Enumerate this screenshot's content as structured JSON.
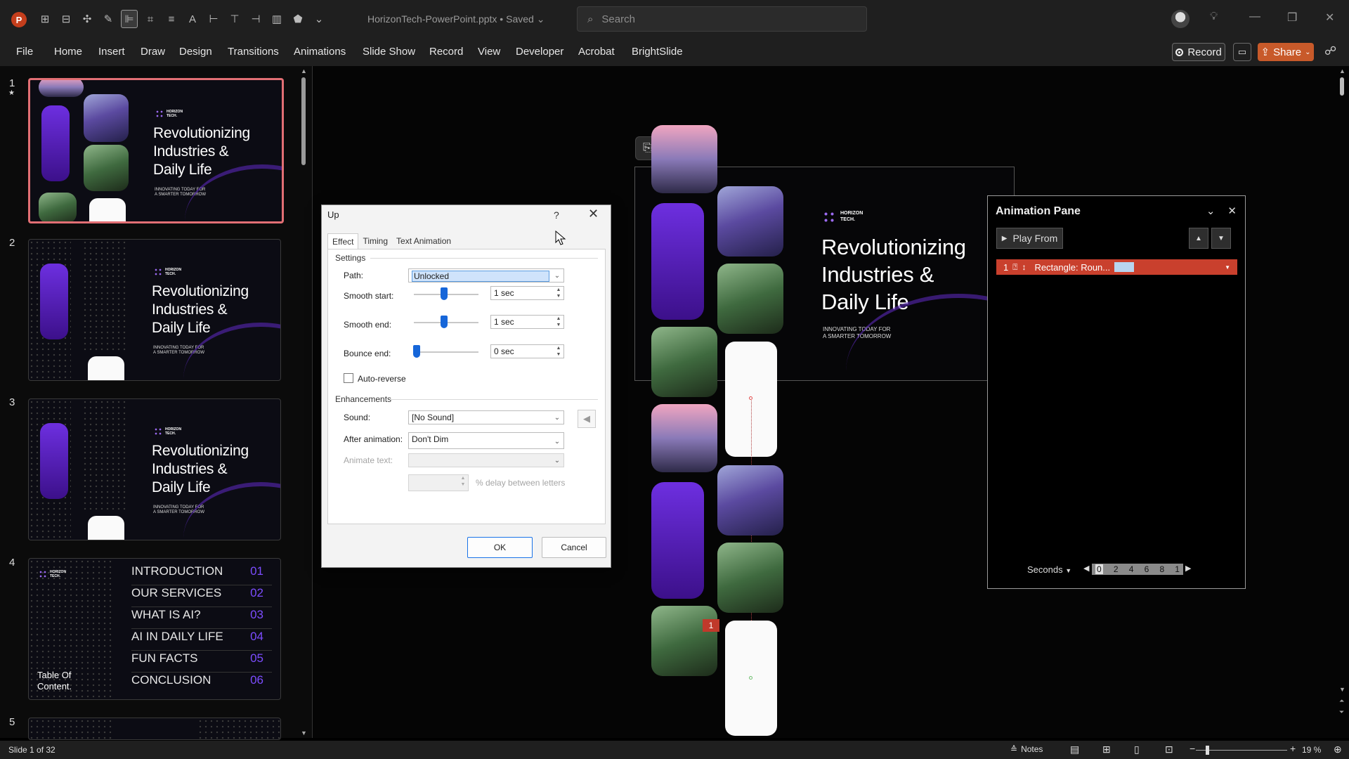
{
  "titlebar": {
    "app_logo": "P",
    "doc_title": "HorizonTech-PowerPoint.pptx • Saved",
    "search_placeholder": "Search",
    "qat_icons": [
      "shape-merge-icon",
      "shape-union-icon",
      "shape-combine-icon",
      "brush-icon",
      "format-align-icon",
      "crop-icon",
      "text-direction-icon",
      "text-icon",
      "align-left-icon",
      "align-top-icon",
      "align-right-icon",
      "chart-icon",
      "shape-icon",
      "more-icon"
    ]
  },
  "menu": {
    "items": [
      "File",
      "Home",
      "Insert",
      "Draw",
      "Design",
      "Transitions",
      "Animations",
      "Slide Show",
      "Record",
      "View",
      "Developer",
      "Acrobat",
      "BrightSlide"
    ],
    "record_label": "Record",
    "share_label": "Share"
  },
  "thumbnails": {
    "numbers": [
      "1",
      "2",
      "3",
      "4",
      "5"
    ],
    "logo_text": "HORIZON TECH.",
    "heading_lines": [
      "Revolutionizing",
      "Industries &",
      "Daily Life"
    ],
    "subtitle_lines": [
      "INNOVATING TODAY FOR",
      "A SMARTER TOMORROW"
    ],
    "toc": {
      "side_title_lines": [
        "Table Of",
        "Content."
      ],
      "rows": [
        {
          "label": "INTRODUCTION",
          "num": "01"
        },
        {
          "label": "OUR SERVICES",
          "num": "02"
        },
        {
          "label": "WHAT IS AI?",
          "num": "03"
        },
        {
          "label": "AI IN DAILY LIFE",
          "num": "04"
        },
        {
          "label": "FUN FACTS",
          "num": "05"
        },
        {
          "label": "CONCLUSION",
          "num": "06"
        }
      ]
    }
  },
  "canvas": {
    "logo_text": "HORIZON TECH.",
    "heading_lines": [
      "Revolutionizing",
      "Industries &",
      "Daily Life"
    ],
    "subtitle_lines": [
      "INNOVATING TODAY FOR",
      "A SMARTER TOMORROW"
    ],
    "anim_badge": "1"
  },
  "dialog": {
    "title": "Up",
    "help": "?",
    "tabs": [
      "Effect",
      "Timing",
      "Text Animation"
    ],
    "settings_title": "Settings",
    "path_label": "Path:",
    "path_value": "Unlocked",
    "smooth_start_label": "Smooth start:",
    "smooth_start_value": "1 sec",
    "smooth_end_label": "Smooth end:",
    "smooth_end_value": "1 sec",
    "bounce_end_label": "Bounce end:",
    "bounce_end_value": "0 sec",
    "auto_reverse_label": "Auto-reverse",
    "auto_reverse_checked": false,
    "enhancements_title": "Enhancements",
    "sound_label": "Sound:",
    "sound_value": "[No Sound]",
    "after_anim_label": "After animation:",
    "after_anim_value": "Don't Dim",
    "animate_text_label": "Animate text:",
    "delay_label": "% delay between letters",
    "ok_label": "OK",
    "cancel_label": "Cancel"
  },
  "anim_pane": {
    "title": "Animation Pane",
    "play_from": "Play From",
    "item_num": "1",
    "item_name": "Rectangle: Roun...",
    "seconds_label": "Seconds",
    "timeline_ticks": [
      "0",
      "2",
      "4",
      "6",
      "8",
      "1"
    ]
  },
  "status": {
    "slide_info": "Slide 1 of 32",
    "notes_label": "Notes",
    "zoom": "19 %"
  },
  "colors": {
    "accent": "#c43e1c",
    "selection": "#e26f74",
    "purple": "#6d2fe0",
    "anim_item": "#c9402d",
    "dialog_primary": "#1a73e8"
  }
}
